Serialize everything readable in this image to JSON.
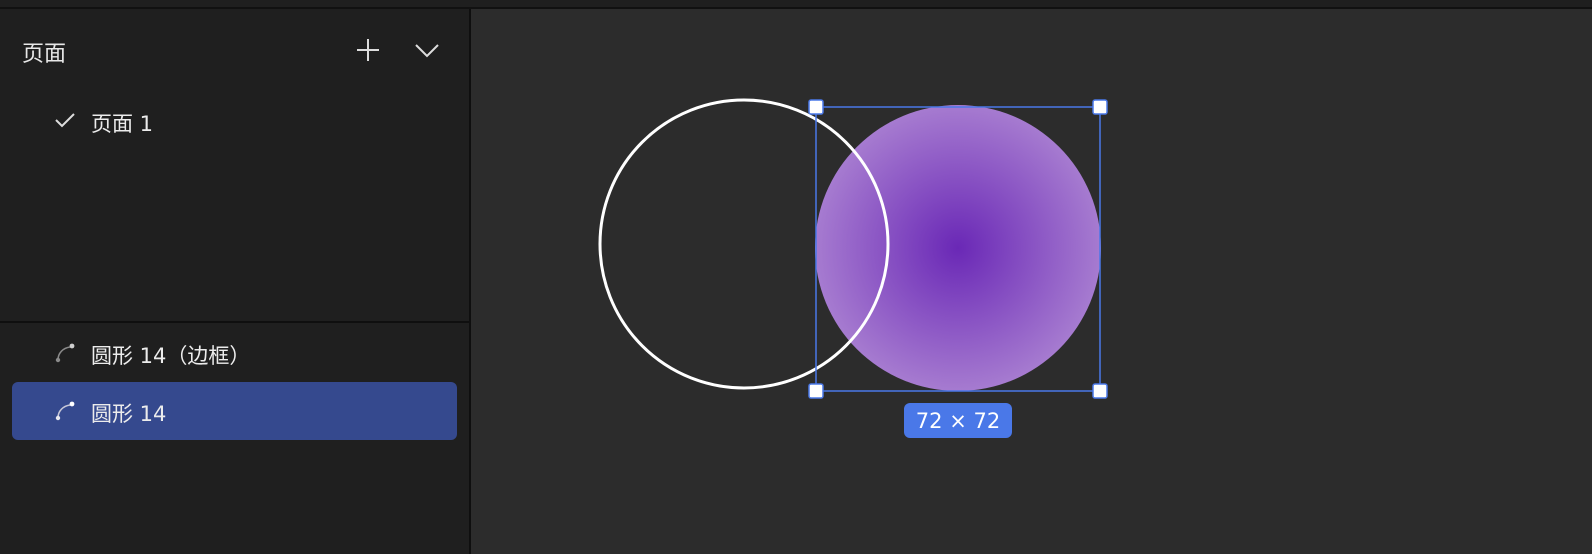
{
  "pages_panel": {
    "title": "页面",
    "add_icon": "plus-icon",
    "collapse_icon": "chevron-down-icon",
    "items": [
      {
        "label": "页面 1",
        "selected": true,
        "icon": "check-icon"
      }
    ]
  },
  "layers_panel": {
    "items": [
      {
        "label": "圆形 14（边框）",
        "icon": "vector-path-icon",
        "selected": false
      },
      {
        "label": "圆形 14",
        "icon": "vector-path-icon",
        "selected": true
      }
    ]
  },
  "canvas": {
    "selection_size_label": "72 × 72",
    "colors": {
      "selection": "#4a78e8",
      "fill_center": "#6a28b6",
      "fill_edge": "#a67bd0",
      "outline": "#ffffff"
    }
  }
}
